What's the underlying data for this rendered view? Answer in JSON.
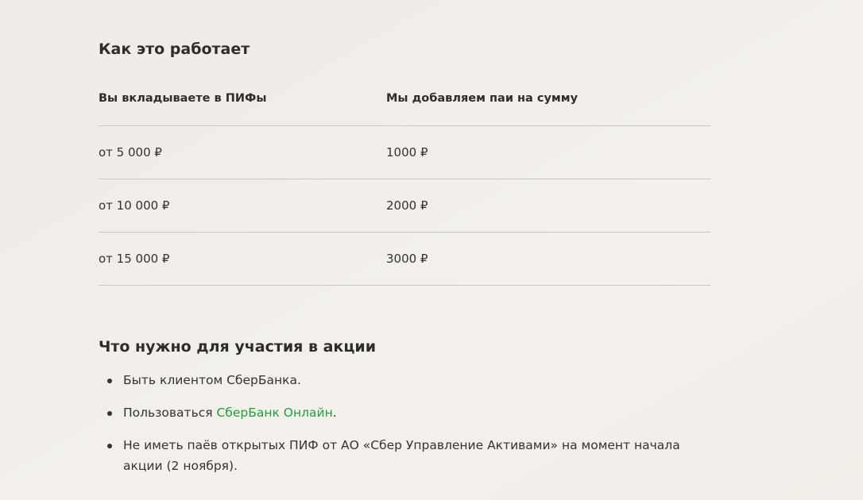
{
  "how_it_works": {
    "title": "Как это работает",
    "headers": [
      "Вы вкладываете в ПИФы",
      "Мы добавляем паи на сумму"
    ],
    "rows": [
      [
        "от 5 000 ₽",
        "1000 ₽"
      ],
      [
        "от 10 000 ₽",
        "2000 ₽"
      ],
      [
        "от 15 000 ₽",
        "3000 ₽"
      ]
    ]
  },
  "requirements": {
    "title": "Что нужно для участия в акции",
    "item1": "Быть клиентом СберБанка.",
    "item2_prefix": "Пользоваться ",
    "item2_link": "СберБанк Онлайн",
    "item2_suffix": ".",
    "item3": "Не иметь паёв открытых ПИФ от АО «Сбер Управление Активами» на момент начала акции (2 ноября)."
  },
  "colors": {
    "link": "#21a038",
    "background": "#f2efeb",
    "divider": "#cbc7c2"
  }
}
